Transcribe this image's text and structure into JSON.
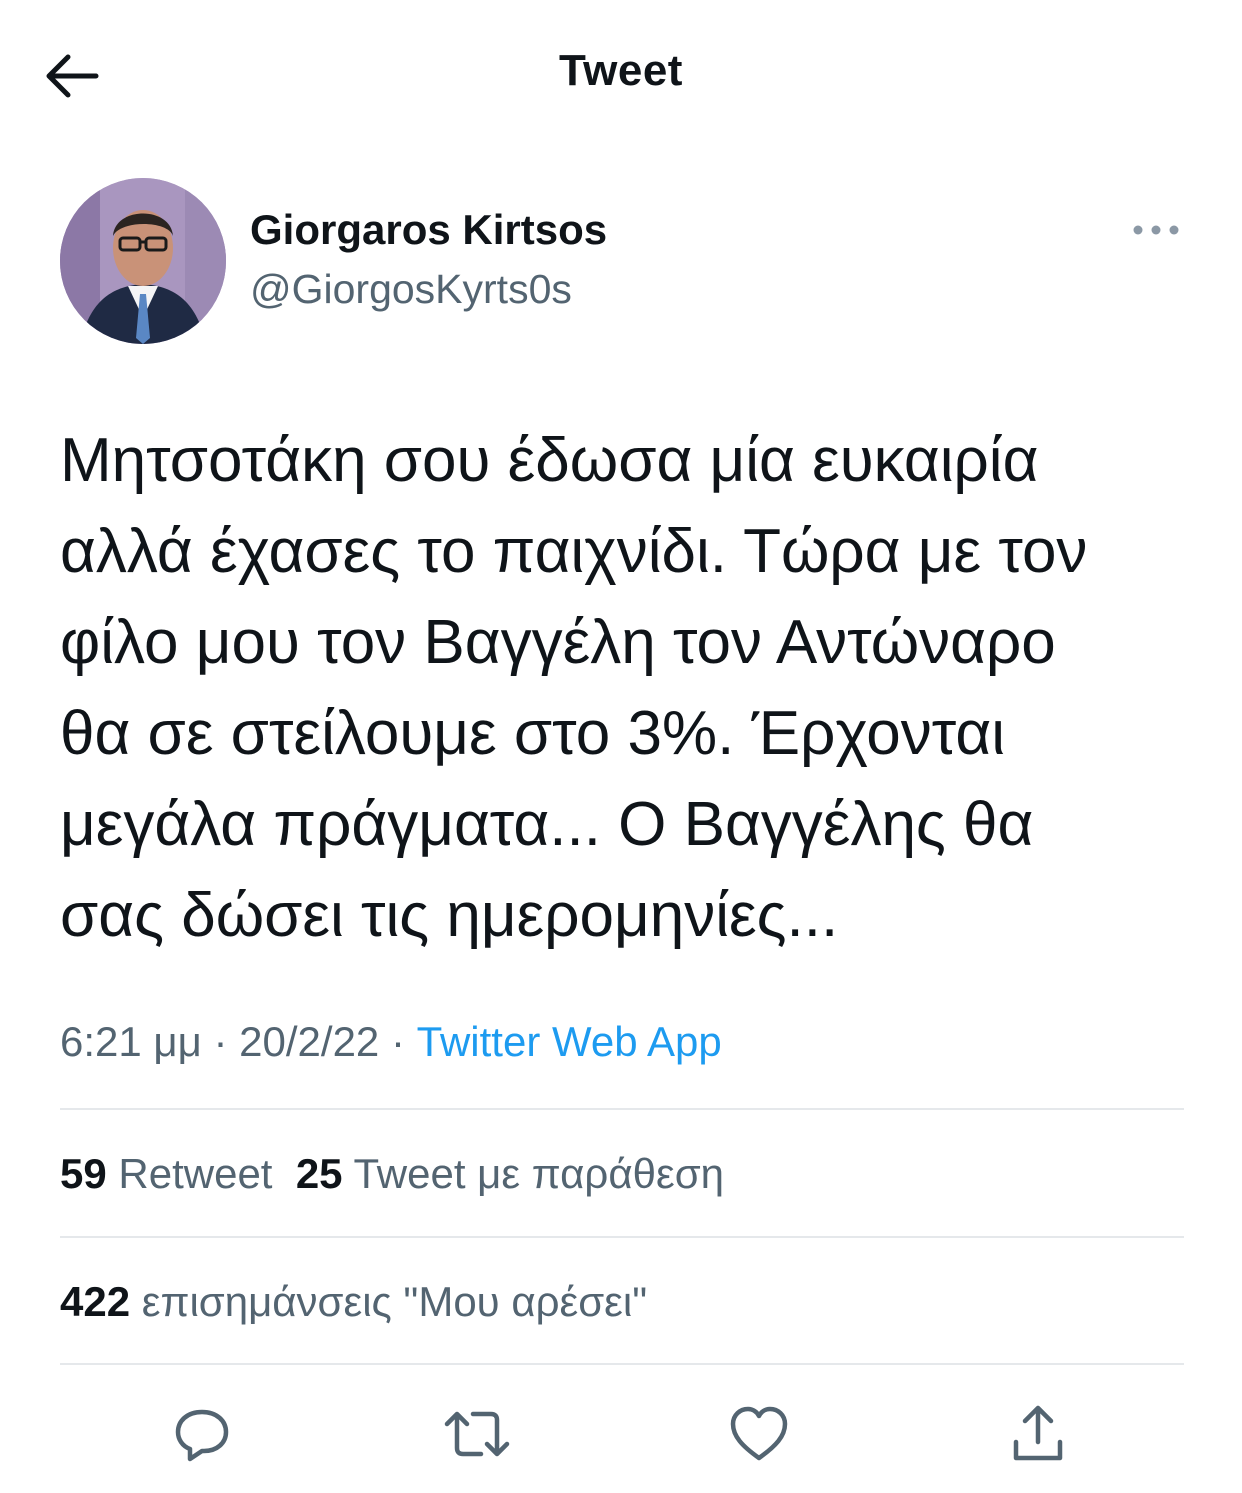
{
  "header": {
    "title": "Tweet",
    "back_icon": "arrow-left-icon"
  },
  "author": {
    "name": "Giorgaros Kirtsos",
    "handle": "@GiorgosKyrts0s",
    "avatar": "profile-photo"
  },
  "tweet": {
    "text": "Μητσοτάκη σου έδωσα μία ευκαιρία\nαλλά έχασες το παιχνίδι. Τώρα με τον\nφίλο μου τον Βαγγέλη τον Αντώναρο\nθα σε στείλουμε στο 3%. Έρχονται\nμεγάλα πράγματα... Ο Βαγγέλης θα\nσας δώσει τις ημερομηνίες...",
    "time": "6:21 μμ",
    "sep1": "·",
    "date": "20/2/22",
    "sep2": "·",
    "source": "Twitter Web App"
  },
  "stats": {
    "retweets": "59",
    "retweets_label": "Retweet",
    "quotes": "25",
    "quotes_label": "Tweet με παράθεση",
    "likes": "422",
    "likes_label": "επισημάνσεις \"Μου αρέσει\""
  },
  "actions": [
    "reply-icon",
    "retweet-icon",
    "like-icon",
    "share-icon"
  ],
  "colors": {
    "text": "#0f1419",
    "secondary": "#536471",
    "link": "#1d9bf0",
    "divider": "#e5e8eb"
  }
}
